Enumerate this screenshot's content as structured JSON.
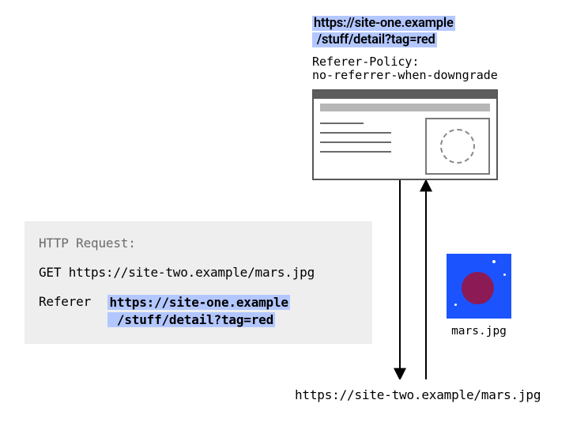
{
  "top_url": {
    "line1": "https://site-one.example",
    "line2": "/stuff/detail?tag=red"
  },
  "policy": {
    "line1": "Referer-Policy:",
    "line2": "no-referrer-when-downgrade"
  },
  "request": {
    "title": "HTTP Request:",
    "get_line": "GET https://site-two.example/mars.jpg",
    "referer_label": "Referer",
    "referer_url_line1": "https://site-one.example",
    "referer_url_line2": "/stuff/detail?tag=red"
  },
  "image": {
    "caption": "mars.jpg"
  },
  "bottom_url": "https://site-two.example/mars.jpg"
}
